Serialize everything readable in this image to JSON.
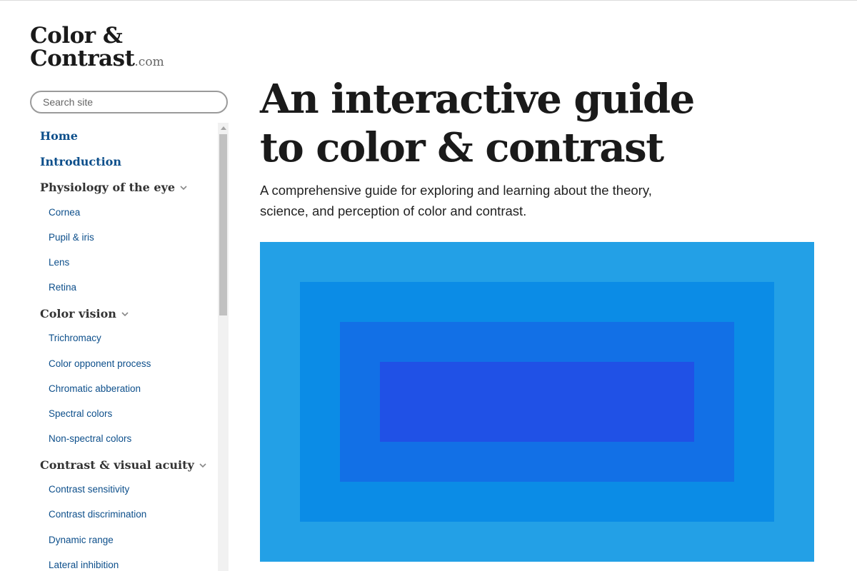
{
  "site": {
    "logo_line1": "Color &",
    "logo_line2": "Contrast",
    "logo_tld": ".com"
  },
  "search": {
    "placeholder": "Search site"
  },
  "nav": {
    "home": "Home",
    "introduction": "Introduction",
    "sections": [
      {
        "label": "Physiology of the eye",
        "items": [
          "Cornea",
          "Pupil & iris",
          "Lens",
          "Retina"
        ]
      },
      {
        "label": "Color vision",
        "items": [
          "Trichromacy",
          "Color opponent process",
          "Chromatic abberation",
          "Spectral colors",
          "Non-spectral colors"
        ]
      },
      {
        "label": "Contrast & visual acuity",
        "items": [
          "Contrast sensitivity",
          "Contrast discrimination",
          "Dynamic range",
          "Lateral inhibition"
        ]
      }
    ],
    "chevron_icon": "chevron-down-icon"
  },
  "main": {
    "title": "An interactive guide to color & contrast",
    "lede": "A comprehensive guide for exploring and learning about the theory, science, and perception of color and contrast."
  },
  "hero": {
    "colors": [
      "#23a0e6",
      "#0b8ce6",
      "#1270e6",
      "#2051e6"
    ]
  },
  "colors": {
    "link": "#0d4f8b",
    "section_heading": "#333333",
    "search_border": "#9a9a9a"
  }
}
